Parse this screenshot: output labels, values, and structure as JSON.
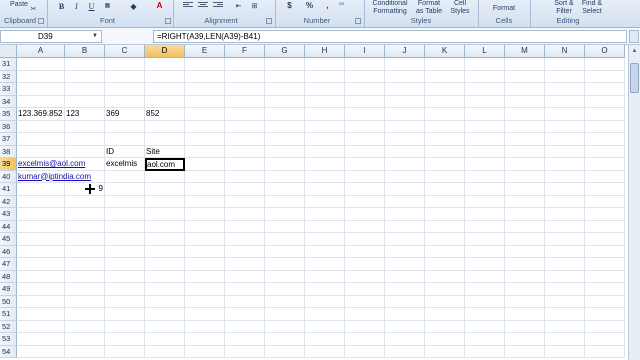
{
  "ribbon": {
    "clipboard": {
      "paste_label": "Paste",
      "group_label": "Clipboard"
    },
    "font": {
      "bold": "B",
      "italic": "I",
      "underline": "U",
      "color_glyph": "A",
      "group_label": "Font"
    },
    "alignment": {
      "group_label": "Alignment"
    },
    "number": {
      "currency": "$",
      "percent": "%",
      "comma": ",",
      "group_label": "Number"
    },
    "styles": {
      "conditional_formatting_line1": "Conditional",
      "conditional_formatting_line2": "Formatting",
      "format_as_table_line1": "Format",
      "format_as_table_line2": "as Table",
      "cell_styles_line1": "Cell",
      "cell_styles_line2": "Styles",
      "group_label": "Styles"
    },
    "cells": {
      "format_label": "Format",
      "group_label": "Cells"
    },
    "editing": {
      "sort_filter_line1": "Sort &",
      "sort_filter_line2": "Filter",
      "find_select_line1": "Find &",
      "find_select_line2": "Select",
      "group_label": "Editing"
    }
  },
  "formula_bar": {
    "name_box": "D39",
    "formula": "=RIGHT(A39,LEN(A39)-B41)"
  },
  "columns": [
    "A",
    "B",
    "C",
    "D",
    "E",
    "F",
    "G",
    "H",
    "I",
    "J",
    "K",
    "L",
    "M",
    "N",
    "O"
  ],
  "rows": [
    "31",
    "32",
    "33",
    "34",
    "35",
    "36",
    "37",
    "38",
    "39",
    "40",
    "41",
    "42",
    "43",
    "44",
    "45",
    "46",
    "47",
    "48",
    "49",
    "50",
    "51",
    "52",
    "53",
    "54"
  ],
  "cells": {
    "A35": "123.369.852",
    "B35": "123",
    "C35": "369",
    "D35": "852",
    "C38": "ID",
    "D38": "Site",
    "A39": "excelmis@aol.com",
    "C39": "excelmis",
    "D39": "aol.com",
    "A40": "kumar@iptindia.com",
    "B41": "9"
  },
  "active_cell": "D39",
  "colors": {
    "ribbon": "#dbe5f1",
    "hyperlink": "#1a0dab",
    "active_header": "#f4c86a",
    "gridline": "#dde4ec"
  }
}
